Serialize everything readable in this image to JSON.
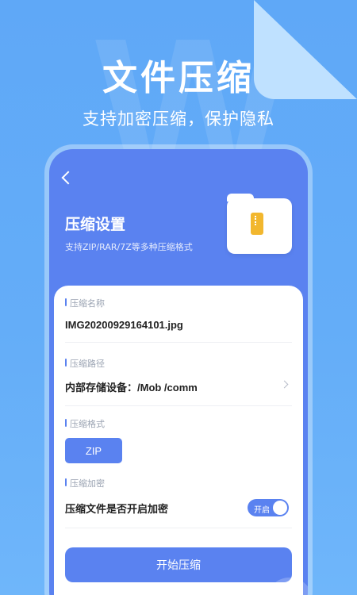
{
  "hero": {
    "title": "文件压缩",
    "subtitle": "支持加密压缩，保护隐私"
  },
  "header": {
    "back_icon": "chevron-left-icon",
    "title": "压缩设置",
    "subtitle": "支持ZIP/RAR/7Z等多种压缩格式"
  },
  "fields": {
    "name_label": "压缩名称",
    "name_value": "IMG20200929164101.jpg",
    "path_label": "压缩路径",
    "path_value": "内部存储设备：/Mob /comm",
    "format_label": "压缩格式",
    "format_value": "ZIP",
    "encrypt_label": "压缩加密",
    "encrypt_question": "压缩文件是否开启加密",
    "encrypt_toggle_text": "开启"
  },
  "actions": {
    "start_label": "开始压缩"
  },
  "colors": {
    "accent": "#5a82f0",
    "background": "#64adf8"
  }
}
